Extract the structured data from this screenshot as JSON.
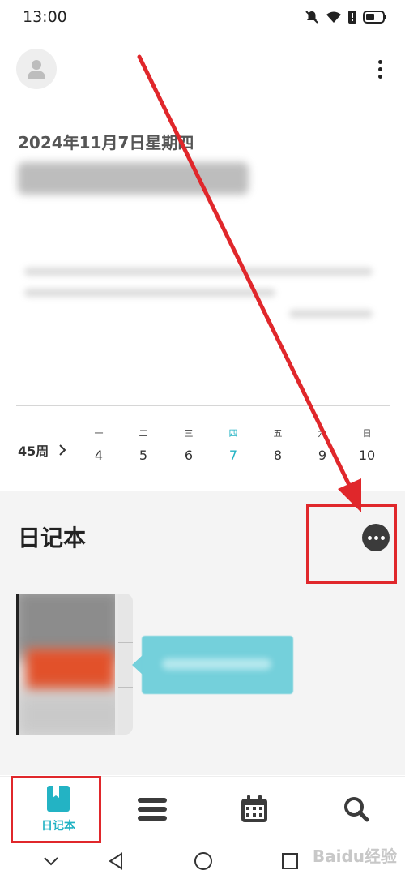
{
  "status_bar": {
    "time": "13:00",
    "icons": [
      "mute-icon",
      "wifi-icon",
      "alert-icon",
      "battery-icon"
    ]
  },
  "header": {
    "avatar_icon": "person-icon",
    "menu_icon": "more-vert-icon"
  },
  "entry": {
    "date_title": "2024年11月7日星期四"
  },
  "week": {
    "label": "45周",
    "days": [
      {
        "name": "一",
        "num": "4"
      },
      {
        "name": "二",
        "num": "5"
      },
      {
        "name": "三",
        "num": "6"
      },
      {
        "name": "四",
        "num": "7"
      },
      {
        "name": "五",
        "num": "8"
      },
      {
        "name": "六",
        "num": "9"
      },
      {
        "name": "日",
        "num": "10"
      }
    ],
    "selected_day": "7",
    "accent": "#23b3c4"
  },
  "notebooks": {
    "title": "日记本",
    "more_icon": "more-horiz-icon"
  },
  "bottom_nav": {
    "items": [
      {
        "label": "日记本",
        "icon": "notebook-icon"
      },
      {
        "icon": "list-icon"
      },
      {
        "icon": "calendar-icon"
      },
      {
        "icon": "search-icon"
      }
    ]
  },
  "system_nav": {
    "icons": [
      "chevron-down-icon",
      "back-icon",
      "home-icon",
      "recents-icon"
    ]
  },
  "watermark": "Baidu经验",
  "annotation_color": "#e0272b"
}
